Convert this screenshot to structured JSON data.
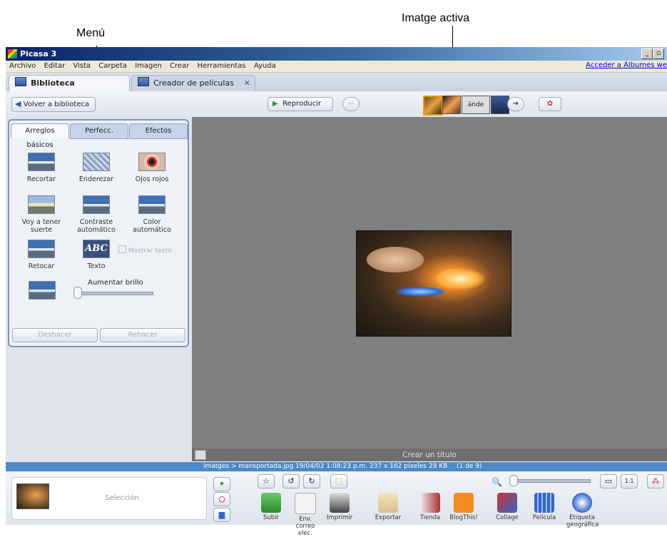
{
  "annotations": {
    "menu": "Menú",
    "active_image": "Imatge activa"
  },
  "window": {
    "title": "Picasa 3"
  },
  "menubar": {
    "items": [
      "Archivo",
      "Editar",
      "Vista",
      "Carpeta",
      "Imagen",
      "Crear",
      "Herramientas",
      "Ayuda"
    ],
    "account_link": "Acceder a Álbumes we"
  },
  "tabs": [
    {
      "label": "Biblioteca"
    },
    {
      "label": "Creador de películas"
    }
  ],
  "toolbar": {
    "back_label": "Volver a biblioteca",
    "play_label": "Reproducir",
    "thumb_text": "ànde"
  },
  "edit_panel": {
    "tabs": [
      "Arreglos básicos",
      "Perfecc.",
      "Efectos"
    ],
    "tools": [
      {
        "label": "Recortar"
      },
      {
        "label": "Enderezar"
      },
      {
        "label": "Ojos rojos"
      },
      {
        "label": "Voy a tener suerte"
      },
      {
        "label": "Contraste automático"
      },
      {
        "label": "Color automático"
      },
      {
        "label": "Retocar"
      },
      {
        "label": "Texto"
      }
    ],
    "text_icon": "ABC",
    "checkbox_label": "Mostrar texto",
    "brightness_label": "Aumentar brillo",
    "undo_label": "Deshacer",
    "redo_label": "Rehacer"
  },
  "caption_placeholder": "Crear un título",
  "status": {
    "path": "imatges > mansportada.jpg",
    "date": "19/04/02 1:08:23 p.m.",
    "dims": "237 x 162 píxeles",
    "size": "29 KB",
    "index": "(1 de 9)"
  },
  "bottom": {
    "selection_label": "Selección",
    "zoom_1to1": "1:1",
    "actions": [
      "Subir",
      "Env. correo elec.",
      "Imprimir",
      "Exportar",
      "Tienda",
      "BlogThis!",
      "Collage",
      "Película",
      "Etiqueta geográfica"
    ]
  },
  "colors": {
    "title_bar": "#0a246a",
    "status_bar": "#4d89c7",
    "panel_border": "#7b93c5",
    "viewer_bg": "#808080"
  }
}
